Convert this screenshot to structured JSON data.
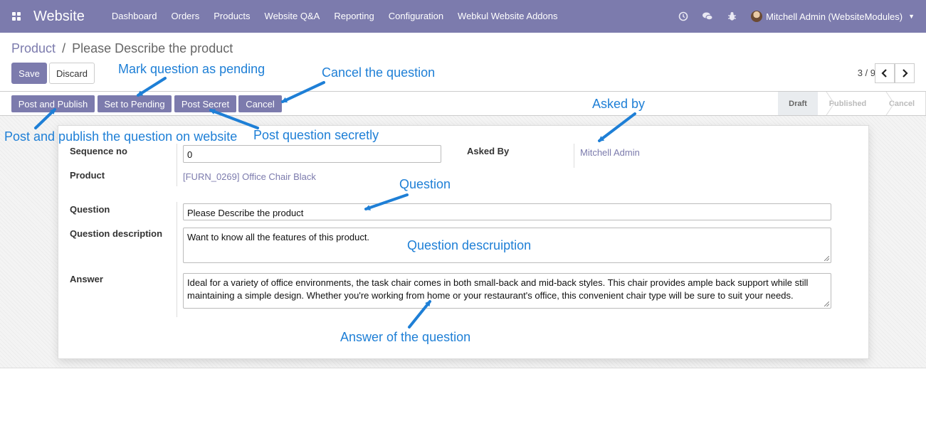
{
  "navbar": {
    "brand": "Website",
    "menu": [
      "Dashboard",
      "Orders",
      "Products",
      "Website Q&A",
      "Reporting",
      "Configuration",
      "Webkul Website Addons"
    ],
    "user": "Mitchell Admin (WebsiteModules)"
  },
  "breadcrumb": {
    "parent": "Product",
    "separator": "/",
    "current": "Please Describe the product"
  },
  "buttons": {
    "save": "Save",
    "discard": "Discard"
  },
  "pager": {
    "value": "3 / 9"
  },
  "statusbar": {
    "actions": [
      "Post and Publish",
      "Set to Pending",
      "Post Secret",
      "Cancel"
    ],
    "stages": [
      "Draft",
      "Published",
      "Cancel"
    ],
    "active_stage": "Draft"
  },
  "form": {
    "sequence_label": "Sequence no",
    "sequence_value": "0",
    "product_label": "Product",
    "product_value": "[FURN_0269] Office Chair Black",
    "asked_by_label": "Asked By",
    "asked_by_value": "Mitchell Admin",
    "question_label": "Question",
    "question_value": "Please Describe the product",
    "description_label": "Question description",
    "description_value": "Want to know all the features of this product.",
    "answer_label": "Answer",
    "answer_value": "Ideal for a variety of office environments, the task chair comes in both small-back and mid-back styles. This chair provides ample back support while still maintaining a simple design. Whether you're working from home or your restaurant's office, this convenient chair type will be sure to suit your needs."
  },
  "annotations": {
    "pending": "Mark question as pending",
    "cancel": "Cancel the question",
    "asked_by": "Asked by",
    "post_publish": "Post and publish the question on website",
    "post_secret": "Post question secretly",
    "question": "Question",
    "description": "Question descruiption",
    "answer": "Answer of the question"
  },
  "colors": {
    "brand": "#7c7bad",
    "annotation": "#1e7fd6"
  },
  "icons": [
    "apps-icon",
    "clock-icon",
    "chat-icon",
    "bug-icon",
    "chevron-left-icon",
    "chevron-right-icon"
  ]
}
